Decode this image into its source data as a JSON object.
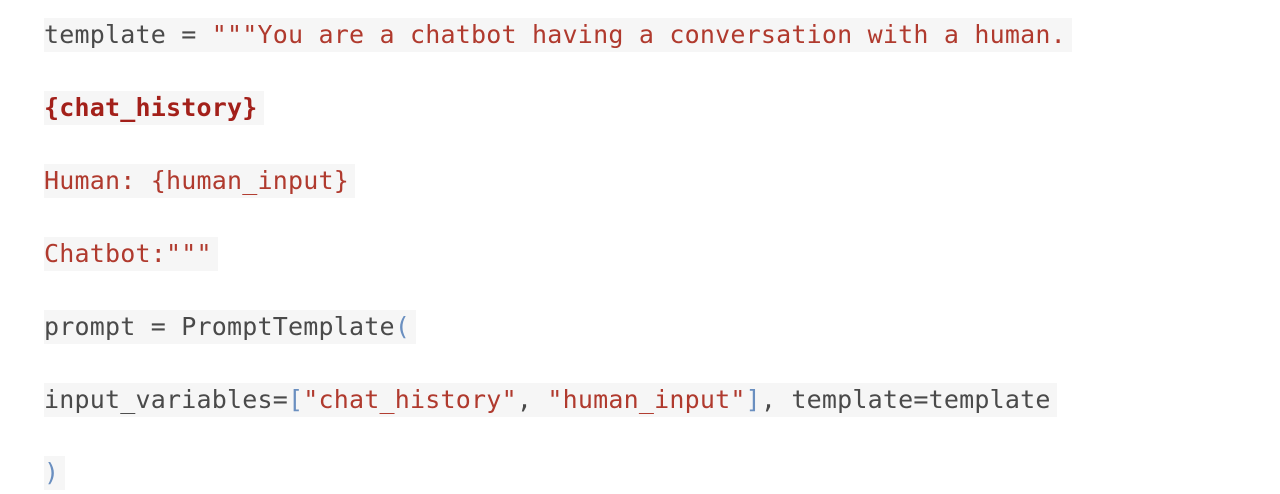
{
  "code": {
    "line1": {
      "var": "template",
      "op": " = ",
      "string": "\"\"\"You are a chatbot having a conversation with a human."
    },
    "line2": {
      "placeholder": "{chat_history}"
    },
    "line3": {
      "string": "Human: {human_input}"
    },
    "line4": {
      "string": "Chatbot:\"\"\""
    },
    "line5": {
      "var": "prompt",
      "op": " = ",
      "call": "PromptTemplate",
      "paren": "("
    },
    "line6": {
      "kwarg1": "input_variables=",
      "bracket_open": "[",
      "item1": "\"chat_history\"",
      "sep": ", ",
      "item2": "\"human_input\"",
      "bracket_close": "]",
      "comma": ", ",
      "kwarg2": "template=template"
    },
    "line7": {
      "paren": ")"
    }
  }
}
